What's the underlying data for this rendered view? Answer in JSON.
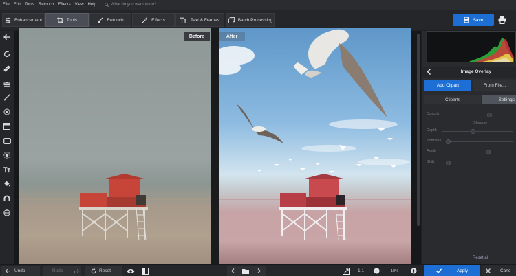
{
  "menu": {
    "items": [
      "File",
      "Edit",
      "Tools",
      "Retouch",
      "Effects",
      "View",
      "Help"
    ],
    "search_placeholder": "What do you want to do?"
  },
  "toolbar": {
    "tabs": [
      {
        "label": "Enhancement",
        "icon": "sliders-icon"
      },
      {
        "label": "Tools",
        "icon": "crop-icon",
        "active": true
      },
      {
        "label": "Retouch",
        "icon": "brush-icon"
      },
      {
        "label": "Effects",
        "icon": "magic-wand-icon"
      },
      {
        "label": "Text & Frames",
        "icon": "text-icon"
      },
      {
        "label": "Batch Processing",
        "icon": "batch-icon"
      }
    ],
    "save_label": "Save"
  },
  "canvas": {
    "before_label": "Before",
    "after_label": "After"
  },
  "panel": {
    "title": "Image Overlay",
    "add_clipart": "Add Clipart",
    "from_file": "From File...",
    "tab_cliparts": "Cliparts",
    "tab_settings": "Settings",
    "opacity_label": "Opacity",
    "shadow_label": "Shadow",
    "depth_label": "Depth",
    "softness_label": "Softness",
    "angle_label": "Angle",
    "shift_label": "Shift",
    "reset_all": "Reset all"
  },
  "bottom": {
    "undo": "Undo",
    "redo": "Redo",
    "reset": "Reset",
    "zoom_ratio": "1:1",
    "zoom_percent": "18%",
    "apply": "Apply",
    "cancel": "Canc"
  },
  "colors": {
    "accent": "#1d6fd6",
    "background": "#1f2023",
    "panel": "#2a2b2f"
  }
}
